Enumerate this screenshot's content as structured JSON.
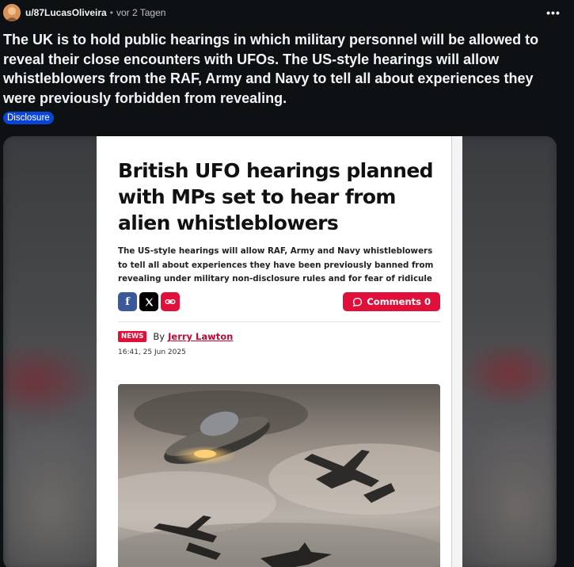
{
  "post": {
    "username": "u/87LucasOliveira",
    "separator": "•",
    "time_ago": "vor 2 Tagen",
    "more_label": "•••",
    "title": "The UK is to hold public hearings in which military personnel will be allowed to reveal their close encounters with UFOs. The US-style hearings will allow whistleblowers from the RAF, Army and Navy to tell all about experiences they were previously forbidden from revealing.",
    "flair": "Disclosure"
  },
  "article": {
    "headline": "British UFO hearings planned with MPs set to hear from alien whistleblowers",
    "subheadline": "The US-style hearings will allow RAF, Army and Navy whistleblowers to tell all about experiences they have been previously banned from revealing under military non-disclosure rules and for fear of ridicule",
    "share": {
      "facebook_glyph": "f",
      "x_glyph": "𝕏"
    },
    "comments_label": "Comments 0",
    "badge": "NEWS",
    "by_label": "By",
    "author": "Jerry Lawton",
    "date": "16:41, 25 Jun 2025"
  },
  "colors": {
    "background": "#0e1113",
    "flair": "#0a45d8",
    "accent_red": "#e0103a",
    "facebook": "#3b5998"
  },
  "icons": [
    "avatar-icon",
    "more-options-icon",
    "facebook-icon",
    "x-icon",
    "link-icon",
    "comment-icon"
  ]
}
